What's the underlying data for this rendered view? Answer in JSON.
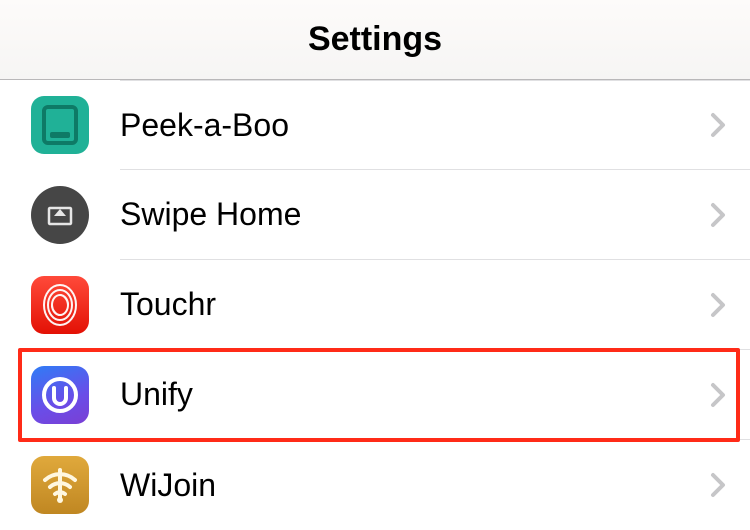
{
  "navbar": {
    "title": "Settings"
  },
  "rows": [
    {
      "id": "peek-a-boo",
      "label": "Peek-a-Boo",
      "highlighted": false
    },
    {
      "id": "swipe-home",
      "label": "Swipe Home",
      "highlighted": false
    },
    {
      "id": "touchr",
      "label": "Touchr",
      "highlighted": false
    },
    {
      "id": "unify",
      "label": "Unify",
      "highlighted": true
    },
    {
      "id": "wijoin",
      "label": "WiJoin",
      "highlighted": false
    }
  ],
  "colors": {
    "highlight": "#ff2b18",
    "chevron": "#c6c6c8",
    "separator": "#e0e0e2"
  }
}
